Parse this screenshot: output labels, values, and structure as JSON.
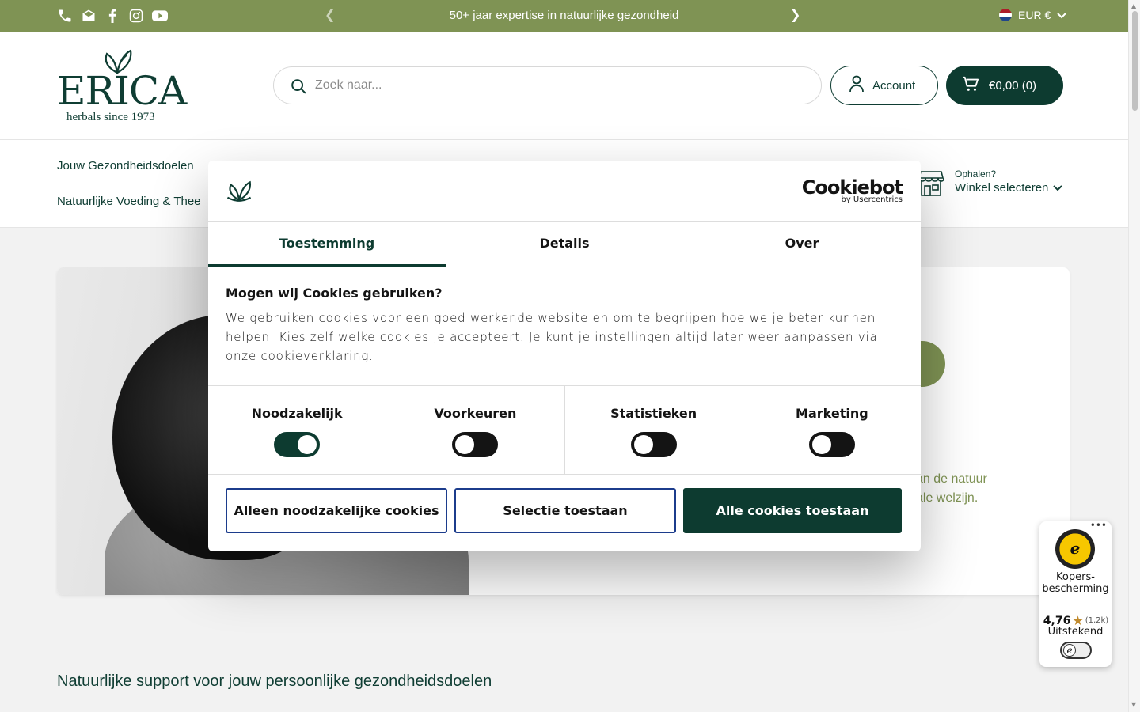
{
  "topbar": {
    "announcement": "50+ jaar expertise in natuurlijke gezondheid",
    "currency": "EUR €",
    "icons": [
      "phone-icon",
      "mail-icon",
      "facebook-icon",
      "instagram-icon",
      "youtube-icon"
    ],
    "bg_color": "#7f9354"
  },
  "header": {
    "logo_word": "ERICA",
    "logo_tagline": "herbals since 1973",
    "search_placeholder": "Zoek naar...",
    "account_label": "Account",
    "cart_label": "€0,00 (0)",
    "brand_color": "#0d3b30"
  },
  "nav": {
    "items": [
      "Jouw Gezondheidsdoelen",
      "Natuurlijke Voeding & Thee"
    ],
    "store_small": "Ophalen?",
    "store_big": "Winkel selecteren"
  },
  "hero": {
    "text_line1": "an de natuur",
    "text_line2": "ale welzijn."
  },
  "section_title": "Natuurlijke support voor jouw persoonlijke gezondheidsdoelen",
  "cookie": {
    "brand": "Cookiebot",
    "brand_sub": "by Usercentrics",
    "tabs": [
      "Toestemming",
      "Details",
      "Over"
    ],
    "active_tab": "Toestemming",
    "title": "Mogen wij Cookies gebruiken?",
    "body": "We gebruiken cookies voor een goed werkende website en om te begrijpen hoe we je beter kunnen helpen. Kies zelf welke cookies je accepteert. Je kunt je instellingen altijd later weer aanpassen via onze cookieverklaring.",
    "toggles": [
      {
        "label": "Noodzakelijk",
        "on": true
      },
      {
        "label": "Voorkeuren",
        "on": false
      },
      {
        "label": "Statistieken",
        "on": false
      },
      {
        "label": "Marketing",
        "on": false
      }
    ],
    "buttons": {
      "necessary": "Alleen noodzakelijke cookies",
      "selection": "Selectie toestaan",
      "all": "Alle cookies toestaan"
    }
  },
  "badge": {
    "label": "Kopers-bescherming",
    "score": "4,76",
    "count": "(1,2k)",
    "grade": "Uitstekend"
  }
}
